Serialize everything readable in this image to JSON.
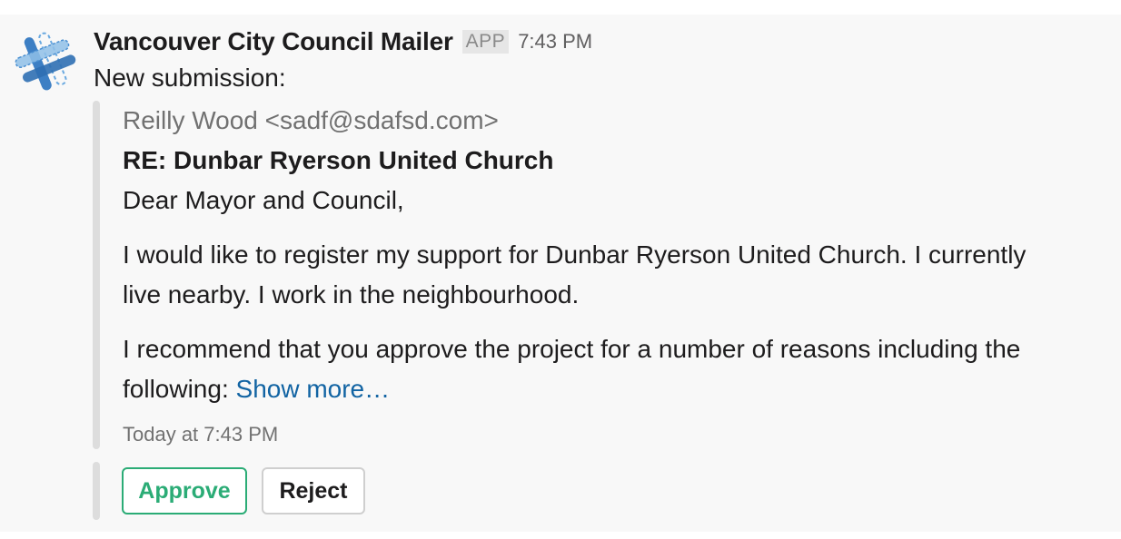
{
  "message": {
    "sender": "Vancouver City Council Mailer",
    "badge": "APP",
    "time": "7:43 PM",
    "intro": "New submission:",
    "avatar_icon": "slack-hash-logo-icon",
    "attachment": {
      "from": "Reilly Wood <sadf@sdafsd.com>",
      "subject": "RE: Dunbar Ryerson United Church",
      "salutation": "Dear Mayor and Council,",
      "para1_line1": "I would like to register my support for Dunbar Ryerson United Church. I currently",
      "para1_line2": "live nearby. I work in the neighbourhood.",
      "para2_line1": "I recommend that you approve the project for a number of reasons including the",
      "para2_line2_prefix": "following: ",
      "show_more": "Show more…",
      "footer": "Today at 7:43 PM"
    },
    "actions": {
      "approve": "Approve",
      "reject": "Reject"
    },
    "colors": {
      "approve": "#2bac76",
      "link": "#1264a3",
      "background": "#f8f8f8"
    }
  }
}
